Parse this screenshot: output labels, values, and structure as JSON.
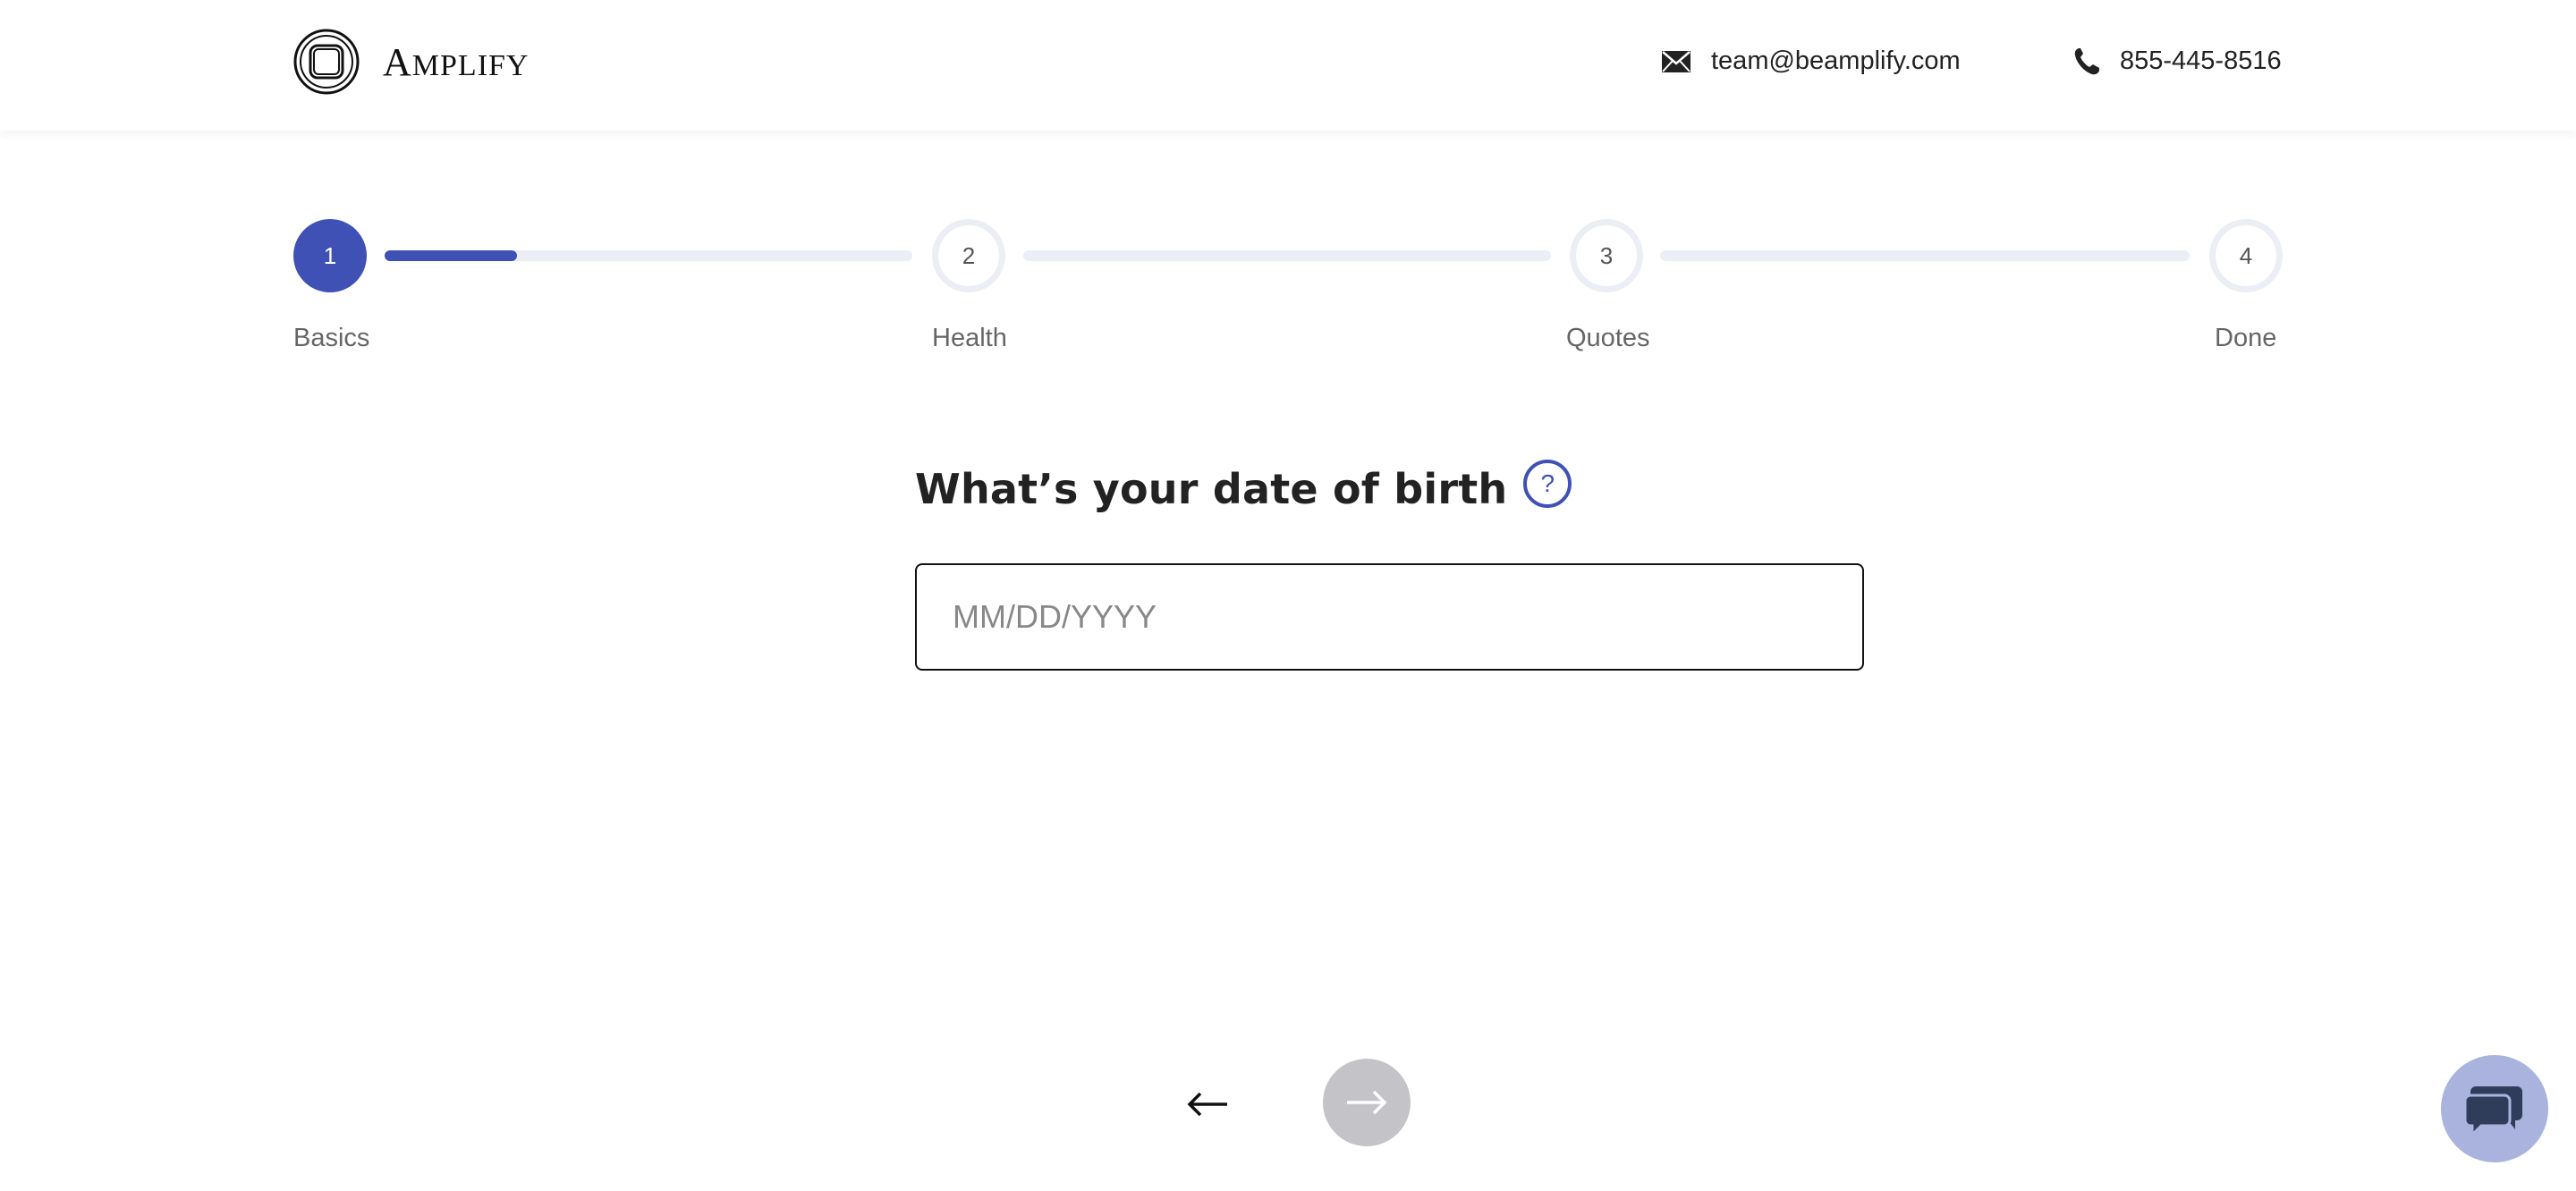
{
  "brand": {
    "name_first": "A",
    "name_rest": "MPLIFY",
    "logo_icon": "amplify-logo-icon"
  },
  "contact": {
    "email": "team@beamplify.com",
    "email_icon": "envelope-icon",
    "phone": "855-445-8516",
    "phone_icon": "phone-icon"
  },
  "stepper": {
    "progress_fraction_step1": 0.25,
    "steps": [
      {
        "number": "1",
        "label": "Basics",
        "state": "active"
      },
      {
        "number": "2",
        "label": "Health",
        "state": "upcoming"
      },
      {
        "number": "3",
        "label": "Quotes",
        "state": "upcoming"
      },
      {
        "number": "4",
        "label": "Done",
        "state": "upcoming"
      }
    ]
  },
  "question": {
    "title": "What’s your date of birth",
    "help_symbol": "?",
    "input_placeholder": "MM/DD/YYYY",
    "input_value": ""
  },
  "navigation": {
    "back_icon": "arrow-left-icon",
    "next_icon": "arrow-right-icon",
    "next_enabled": false
  },
  "chat": {
    "icon": "chat-bubbles-icon"
  },
  "colors": {
    "accent": "#3f51b5",
    "track": "#eceef6",
    "next_disabled": "#c4c4c8",
    "chat_bg": "#aab3de",
    "chat_icon": "#2f3d5a"
  }
}
